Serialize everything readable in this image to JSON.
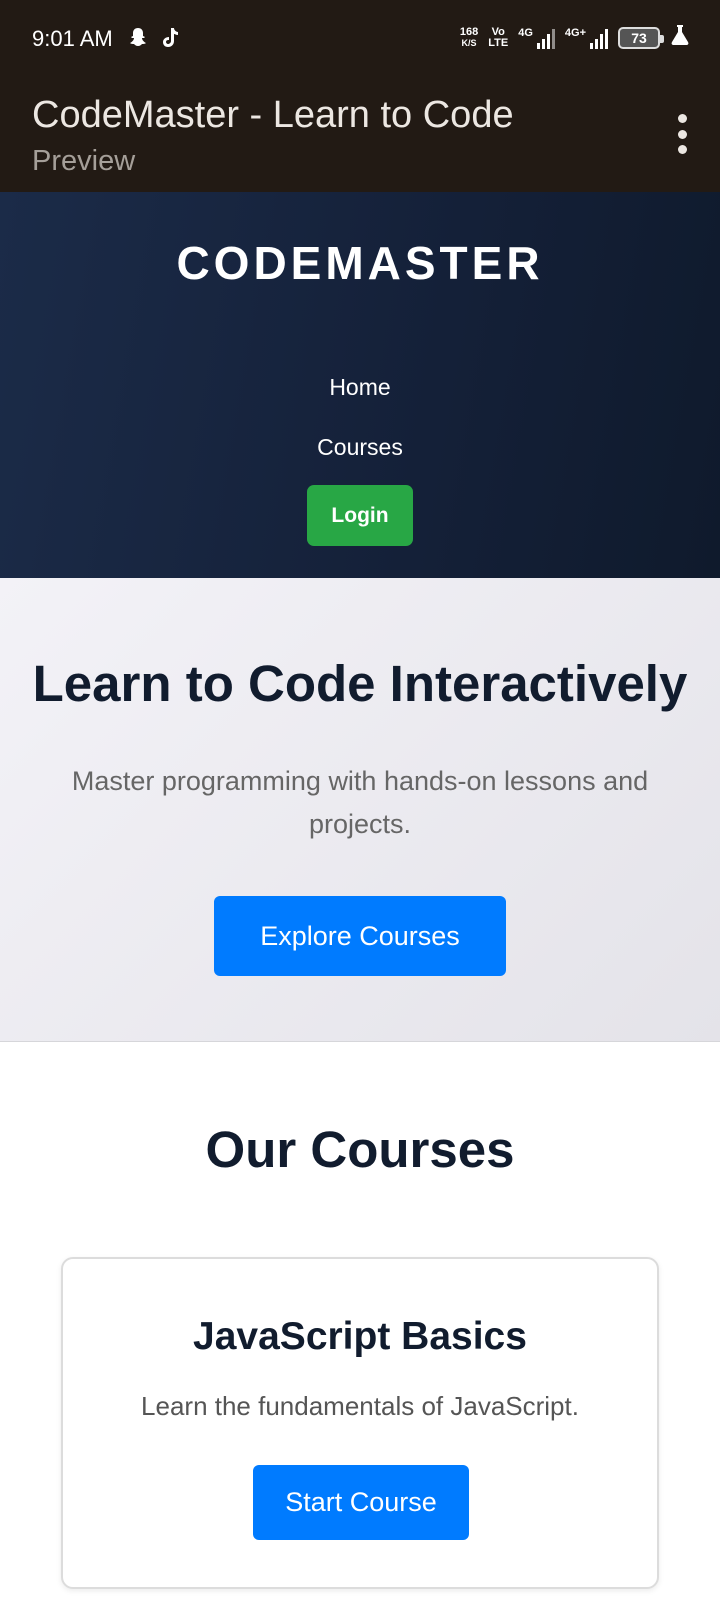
{
  "status_bar": {
    "time": "9:01 AM",
    "net_speed_value": "168",
    "net_speed_unit": "K/S",
    "volte_top": "Vo",
    "volte_bottom": "LTE",
    "sim1_label": "4G",
    "sim2_label": "4G+",
    "battery": "73",
    "icons": [
      "snapchat-icon",
      "tiktok-icon",
      "signal-icon",
      "battery-icon",
      "flask-icon"
    ]
  },
  "app_bar": {
    "title": "CodeMaster - Learn to Code",
    "subtitle": "Preview",
    "menu_icon": "more-vert-icon"
  },
  "header": {
    "brand": "CODEMASTER",
    "nav": {
      "home": "Home",
      "courses": "Courses",
      "login": "Login"
    }
  },
  "hero": {
    "title": "Learn to Code Interactively",
    "text": "Master programming with hands-on lessons and projects.",
    "button": "Explore Courses"
  },
  "courses": {
    "title": "Our Courses",
    "items": [
      {
        "name": "JavaScript Basics",
        "description": "Learn the fundamentals of JavaScript.",
        "button": "Start Course"
      }
    ]
  },
  "colors": {
    "system_bar": "#221a14",
    "header_bg": "#1b2b48",
    "login_green": "#28a745",
    "primary_blue": "#007bff",
    "heading": "#111c2e"
  }
}
